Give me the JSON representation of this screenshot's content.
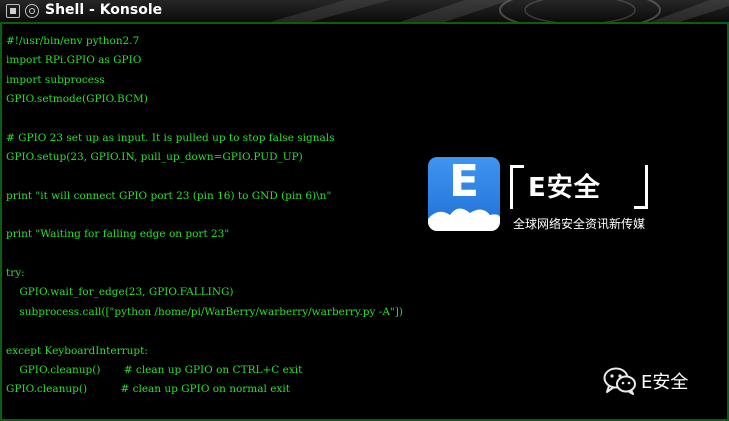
{
  "window": {
    "title": "Shell - Konsole"
  },
  "icons": {
    "menu": "window-menu-icon",
    "pin": "keep-above-icon",
    "wechat": "wechat-icon"
  },
  "colors": {
    "terminal_text": "#27e02d",
    "terminal_bg": "#000000",
    "border": "#0a5d12",
    "logo_blue": "#2f86e8"
  },
  "code_lines": [
    "#!/usr/bin/env python2.7",
    "import RPi.GPIO as GPIO",
    "import subprocess",
    "GPIO.setmode(GPIO.BCM)",
    "",
    "# GPIO 23 set up as input. It is pulled up to stop false signals",
    "GPIO.setup(23, GPIO.IN, pull_up_down=GPIO.PUD_UP)",
    "",
    "print \"it will connect GPIO port 23 (pin 16) to GND (pin 6)\\n\"",
    "",
    "print \"Waiting for falling edge on port 23\"",
    "",
    "try:",
    "    GPIO.wait_for_edge(23, GPIO.FALLING)",
    "    subprocess.call([\"python /home/pi/WarBerry/warberry/warberry.py -A\"])",
    "",
    "except KeyboardInterrupt:",
    "    GPIO.cleanup()       # clean up GPIO on CTRL+C exit",
    "GPIO.cleanup()          # clean up GPIO on normal exit"
  ],
  "logo": {
    "letter": "E",
    "name": "E安全",
    "tagline": "全球网络安全资讯新传媒"
  },
  "watermark": {
    "text": "E安全"
  }
}
